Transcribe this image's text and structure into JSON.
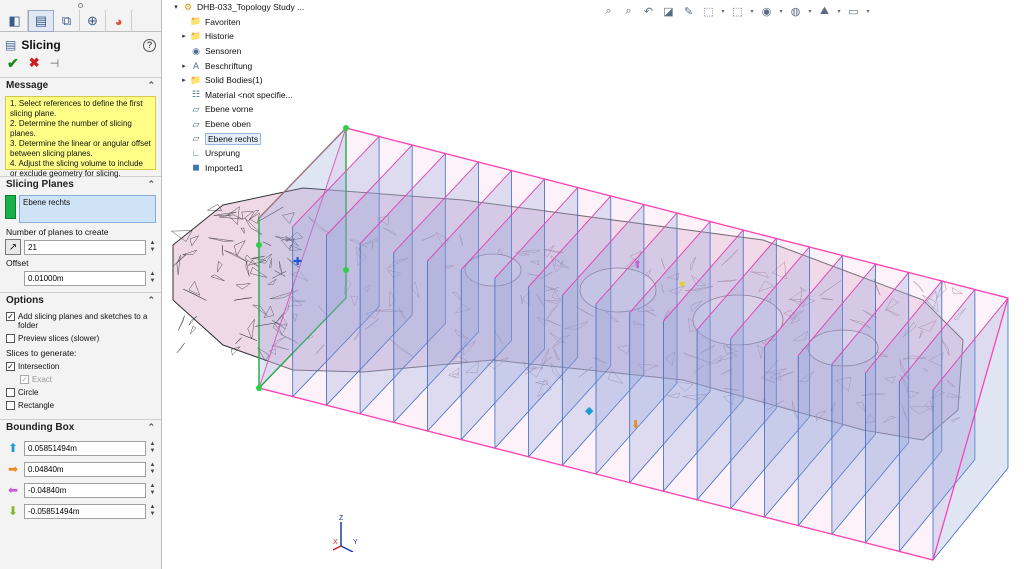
{
  "panel": {
    "tabs": [
      "feature-manager-icon",
      "property-manager-icon",
      "configuration-manager-icon",
      "dim-xpert-icon",
      "display-manager-icon"
    ],
    "title": "Slicing",
    "help": "?",
    "actions": {
      "ok": "✔",
      "cancel": "✖",
      "pin": "⊣"
    },
    "message": {
      "header": "Message",
      "lines": [
        "1. Select references to define the first slicing plane.",
        "2. Determine the number of slicing planes.",
        "3. Determine the linear or angular offset between slicing planes.",
        "4. Adjust the slicing volume to include or exclude geometry for slicing."
      ]
    },
    "slicing_planes": {
      "header": "Slicing Planes",
      "selection": "Ebene rechts",
      "num_label": "Number of planes to create",
      "num_value": "21",
      "offset_label": "Offset",
      "offset_value": "0.01000m"
    },
    "options": {
      "header": "Options",
      "add_slicing": "Add slicing planes and sketches to a folder",
      "preview": "Preview slices (slower)",
      "generate_label": "Slices to generate:",
      "intersection": "Intersection",
      "exact": "Exact",
      "circle": "Circle",
      "rectangle": "Rectangle"
    },
    "bounding_box": {
      "header": "Bounding Box",
      "values": [
        "0.05851494m",
        "0.04840m",
        "-0.04840m",
        "-0.05851494m"
      ],
      "colors": [
        "#1e9bd7",
        "#e8891d",
        "#c85ad8",
        "#8ab322"
      ]
    }
  },
  "tree": {
    "root": "DHB-033_Topology Study ...",
    "items": [
      {
        "label": "Favoriten",
        "icon": "star-folder-icon",
        "expandable": false
      },
      {
        "label": "Historie",
        "icon": "history-folder-icon",
        "expandable": true
      },
      {
        "label": "Sensoren",
        "icon": "sensor-icon",
        "expandable": false
      },
      {
        "label": "Beschriftung",
        "icon": "annotation-icon",
        "expandable": true
      },
      {
        "label": "Solid Bodies(1)",
        "icon": "solid-bodies-folder-icon",
        "expandable": true
      },
      {
        "label": "Material <not specifie...",
        "icon": "material-icon",
        "expandable": false
      },
      {
        "label": "Ebene vorne",
        "icon": "plane-icon",
        "expandable": false
      },
      {
        "label": "Ebene oben",
        "icon": "plane-icon",
        "expandable": false
      },
      {
        "label": "Ebene rechts",
        "icon": "plane-icon",
        "expandable": false,
        "selected": true
      },
      {
        "label": "Ursprung",
        "icon": "origin-icon",
        "expandable": false
      },
      {
        "label": "Imported1",
        "icon": "imported-body-icon",
        "expandable": false
      }
    ]
  },
  "toolbar": [
    "zoom-to-fit-icon",
    "zoom-area-icon",
    "previous-view-icon",
    "section-view-icon",
    "dynamic-annotation-icon",
    "view-orientation-icon",
    "display-style-icon",
    "hide-show-icon",
    "edit-appearance-icon",
    "apply-scene-icon",
    "view-settings-icon"
  ],
  "viewport": {
    "slice_count": 21,
    "plane_color": "#ff3fb4",
    "triad": {
      "x": "X",
      "y": "Y",
      "z": "Z"
    }
  }
}
